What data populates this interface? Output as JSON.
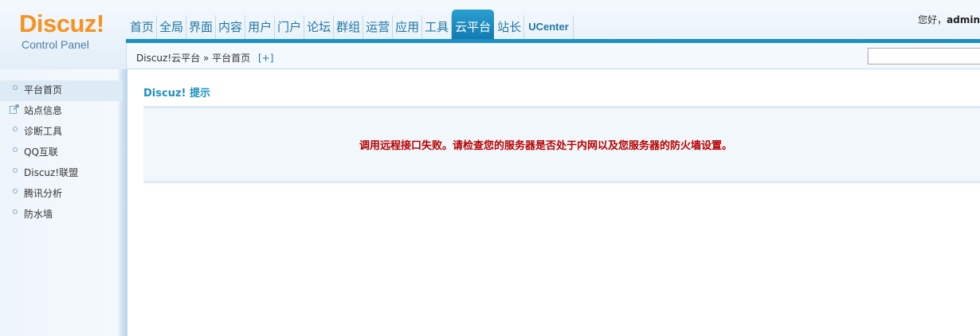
{
  "logo": {
    "title": "Discuz!",
    "subtitle": "Control Panel"
  },
  "nav": {
    "items": [
      "首页",
      "全局",
      "界面",
      "内容",
      "用户",
      "门户",
      "论坛",
      "群组",
      "运营",
      "应用",
      "工具",
      "云平台",
      "站长",
      "UCenter"
    ],
    "active": "云平台"
  },
  "greeting": {
    "prefix": "您好，",
    "user": "admin"
  },
  "breadcrumb": {
    "root": "Discuz!云平台",
    "separator": "»",
    "current": "平台首页",
    "add": "[+]"
  },
  "search": {
    "value": ""
  },
  "sidebar": {
    "items": [
      {
        "label": "平台首页",
        "icon": "circle-bullet-icon",
        "active": true
      },
      {
        "label": "站点信息",
        "icon": "external-link-icon",
        "active": false
      },
      {
        "label": "诊断工具",
        "icon": "circle-bullet-icon",
        "active": false
      },
      {
        "label": "QQ互联",
        "icon": "circle-bullet-icon",
        "active": false
      },
      {
        "label": "Discuz!联盟",
        "icon": "circle-bullet-icon",
        "active": false
      },
      {
        "label": "腾讯分析",
        "icon": "circle-bullet-icon",
        "active": false
      },
      {
        "label": "防水墙",
        "icon": "circle-bullet-icon",
        "active": false
      }
    ]
  },
  "main": {
    "title": "Discuz! 提示",
    "message": "调用远程接口失败。请检查您的服务器是否处于内网以及您服务器的防火墙设置。"
  },
  "colors": {
    "accent": "#1c90c4",
    "logo": "#f7921e",
    "error": "#b80000"
  }
}
